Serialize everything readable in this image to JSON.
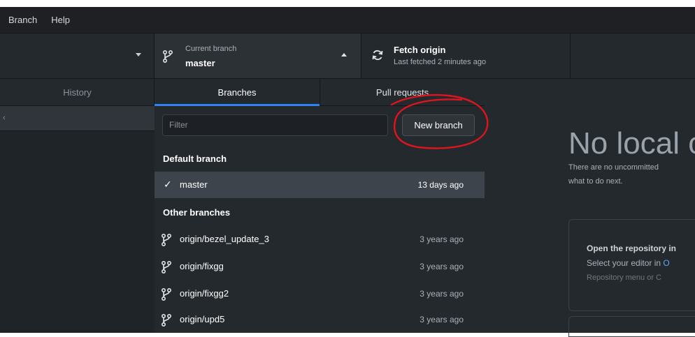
{
  "menu": {
    "items": [
      "Branch",
      "Help"
    ]
  },
  "toolbar": {
    "current_branch_caption": "Current branch",
    "current_branch_value": "master",
    "fetch_title": "Fetch origin",
    "fetch_subtitle": "Last fetched 2 minutes ago"
  },
  "left_panel": {
    "history_tab": "History"
  },
  "branches_panel": {
    "tabs": {
      "branches": "Branches",
      "pull_requests": "Pull requests"
    },
    "filter_placeholder": "Filter",
    "new_branch_button": "New branch",
    "default_section": "Default branch",
    "default_branch": {
      "name": "master",
      "time": "13 days ago"
    },
    "other_section": "Other branches",
    "other_branches": [
      {
        "name": "origin/bezel_update_3",
        "time": "3 years ago"
      },
      {
        "name": "origin/fixgg",
        "time": "3 years ago"
      },
      {
        "name": "origin/fixgg2",
        "time": "3 years ago"
      },
      {
        "name": "origin/upd5",
        "time": "3 years ago"
      }
    ]
  },
  "changes_view": {
    "heading": "No local ch",
    "line1": "There are no uncommitted",
    "line2": "what to do next.",
    "card_title": "Open the repository in",
    "card_line_prefix": "Select your editor in ",
    "card_line_link": "O",
    "card_hint": "Repository menu or  C"
  },
  "colors": {
    "accent_blue": "#2f81f7",
    "annotation_red": "#e0141e",
    "panel_bg": "#24292e",
    "menubar_bg": "#1e2023"
  }
}
